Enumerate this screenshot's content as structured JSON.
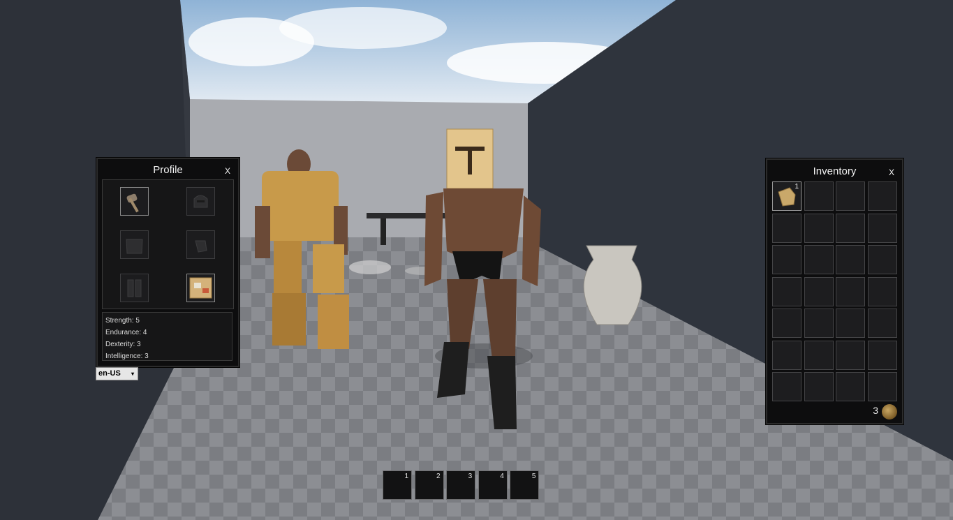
{
  "profile": {
    "title": "Profile",
    "close_label": "X",
    "equipment_slots": [
      {
        "slot": "weapon",
        "filled": true,
        "icon": "axe-icon"
      },
      {
        "slot": "helmet",
        "filled": false,
        "icon": "helmet-icon"
      },
      {
        "slot": "chest",
        "filled": false,
        "icon": "chest-armor-icon"
      },
      {
        "slot": "gloves",
        "filled": false,
        "icon": "gloves-icon"
      },
      {
        "slot": "legs",
        "filled": false,
        "icon": "leg-armor-icon"
      },
      {
        "slot": "accessory",
        "filled": true,
        "icon": "cardboard-box-icon"
      }
    ],
    "stats": [
      "Strength: 5",
      "Endurance: 4",
      "Dexterity: 3",
      "Intelligence: 3"
    ]
  },
  "language": {
    "selected": "en-US",
    "arrow": "▾"
  },
  "inventory": {
    "title": "Inventory",
    "close_label": "X",
    "first_item": {
      "icon": "cardboard-armor-icon",
      "count": "1"
    },
    "gold": "3"
  },
  "hotbar": [
    "1",
    "2",
    "3",
    "4",
    "5"
  ],
  "colors": {
    "panel_bg": "#0d0d0e",
    "slot_bg": "#1d1d1f",
    "wall": "#2a2e36",
    "sky": "#9fc0df"
  }
}
